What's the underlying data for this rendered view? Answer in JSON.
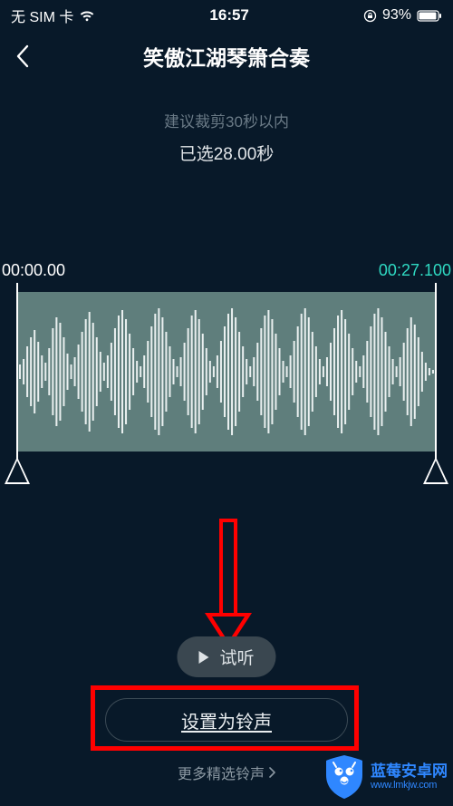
{
  "status": {
    "carrier": "无 SIM 卡",
    "time": "16:57",
    "battery_pct": "93%"
  },
  "header": {
    "title": "笑傲江湖琴箫合奏"
  },
  "hint": "建议裁剪30秒以内",
  "selected": "已选28.00秒",
  "trim": {
    "start_label": "00:00.00",
    "end_label": "00:27.100"
  },
  "buttons": {
    "preview": "试听",
    "set_ringtone": "设置为铃声",
    "more": "更多精选铃声"
  },
  "watermark": {
    "name": "蓝莓安卓网",
    "url": "www.lmkjw.com"
  },
  "colors": {
    "bg": "#081929",
    "wave_bg": "#5f7e7c",
    "accent": "#2fd9c2",
    "annotation": "#ff0000"
  }
}
